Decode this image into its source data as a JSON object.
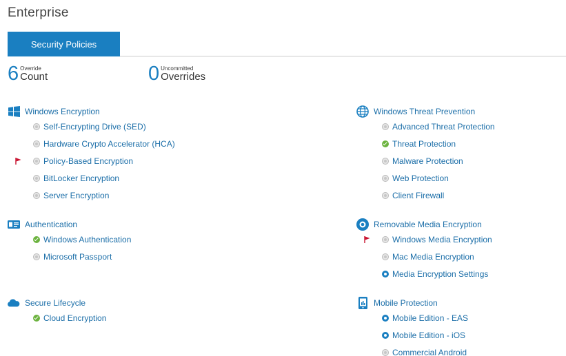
{
  "page": {
    "title": "Enterprise"
  },
  "tabs": {
    "active_label": "Security Policies"
  },
  "stats": {
    "override": {
      "number": "6",
      "small": "Override",
      "big": "Count"
    },
    "uncommitted": {
      "number": "0",
      "small": "Uncommitted",
      "big": "Overrides"
    }
  },
  "groups": {
    "windows_encryption": {
      "title": "Windows Encryption",
      "icon": "windows-logo-icon",
      "items": [
        {
          "label": "Self-Encrypting Drive (SED)",
          "status": "gray",
          "flag": false
        },
        {
          "label": "Hardware Crypto Accelerator (HCA)",
          "status": "gray",
          "flag": false
        },
        {
          "label": "Policy-Based Encryption",
          "status": "gray",
          "flag": true
        },
        {
          "label": "BitLocker Encryption",
          "status": "gray",
          "flag": false
        },
        {
          "label": "Server Encryption",
          "status": "gray",
          "flag": false
        }
      ]
    },
    "authentication": {
      "title": "Authentication",
      "icon": "id-card-icon",
      "items": [
        {
          "label": "Windows Authentication",
          "status": "green",
          "flag": false
        },
        {
          "label": "Microsoft Passport",
          "status": "gray",
          "flag": false
        }
      ]
    },
    "secure_lifecycle": {
      "title": "Secure Lifecycle",
      "icon": "cloud-icon",
      "items": [
        {
          "label": "Cloud Encryption",
          "status": "green",
          "flag": false
        }
      ]
    },
    "windows_threat_prevention": {
      "title": "Windows Threat Prevention",
      "icon": "globe-icon",
      "items": [
        {
          "label": "Advanced Threat Protection",
          "status": "gray",
          "flag": false
        },
        {
          "label": "Threat Protection",
          "status": "green",
          "flag": false
        },
        {
          "label": "Malware Protection",
          "status": "gray",
          "flag": false
        },
        {
          "label": "Web Protection",
          "status": "gray",
          "flag": false
        },
        {
          "label": "Client Firewall",
          "status": "gray",
          "flag": false
        }
      ]
    },
    "removable_media_encryption": {
      "title": "Removable Media Encryption",
      "icon": "disc-icon",
      "items": [
        {
          "label": "Windows Media Encryption",
          "status": "gray",
          "flag": true
        },
        {
          "label": "Mac Media Encryption",
          "status": "gray",
          "flag": false
        },
        {
          "label": "Media Encryption Settings",
          "status": "gear",
          "flag": false
        }
      ]
    },
    "mobile_protection": {
      "title": "Mobile Protection",
      "icon": "mobile-phone-icon",
      "items": [
        {
          "label": "Mobile Edition - EAS",
          "status": "gear",
          "flag": false
        },
        {
          "label": "Mobile Edition - iOS",
          "status": "gear",
          "flag": false
        },
        {
          "label": "Commercial Android",
          "status": "gray",
          "flag": false
        }
      ]
    }
  }
}
